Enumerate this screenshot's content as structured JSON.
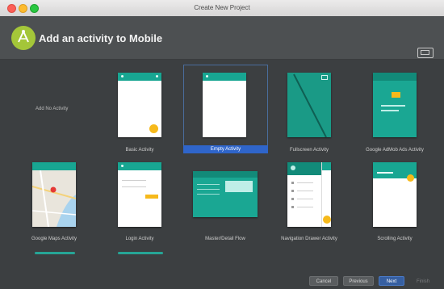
{
  "window": {
    "title": "Create New Project"
  },
  "header": {
    "title": "Add an activity to Mobile"
  },
  "grid": {
    "add_no_activity": "Add No Activity",
    "tiles": [
      {
        "label": "Basic Activity"
      },
      {
        "label": "Empty Activity"
      },
      {
        "label": "Fullscreen Activity"
      },
      {
        "label": "Google AdMob Ads Activity"
      },
      {
        "label": "Google Maps Activity"
      },
      {
        "label": "Login Activity"
      },
      {
        "label": "Master/Detail Flow"
      },
      {
        "label": "Navigation Drawer Activity"
      },
      {
        "label": "Scrolling Activity"
      }
    ]
  },
  "footer": {
    "cancel": "Cancel",
    "previous": "Previous",
    "next": "Next",
    "finish": "Finish"
  },
  "colors": {
    "accent": "#18a692",
    "selection": "#2f65ca",
    "fab": "#f6b91b"
  }
}
